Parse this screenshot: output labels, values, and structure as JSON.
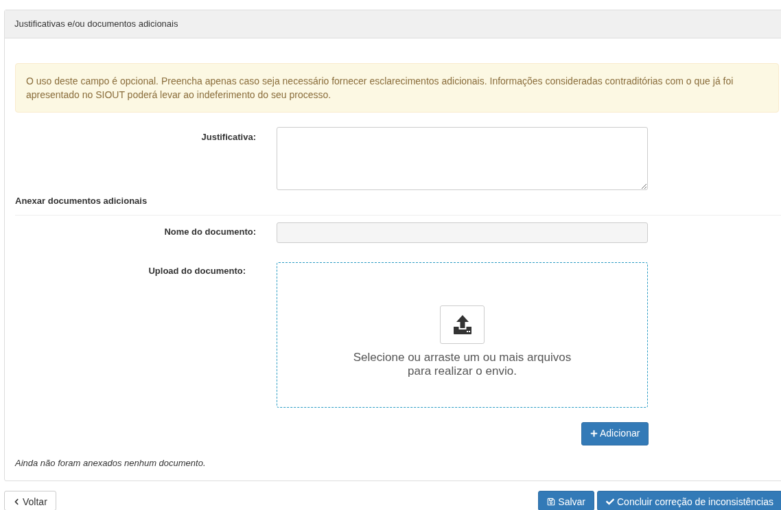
{
  "panel": {
    "title": "Justificativas e/ou documentos adicionais"
  },
  "alert": {
    "text": "O uso deste campo é opcional. Preencha apenas caso seja necessário fornecer esclarecimentos adicionais. Informações consideradas contraditórias com o que já foi apresentado no SIOUT poderá levar ao indeferimento do seu processo."
  },
  "justification": {
    "label": "Justificativa:"
  },
  "attachments": {
    "title": "Anexar documentos adicionais",
    "name_field": {
      "label": "Nome do documento:"
    },
    "upload": {
      "label": "Upload do documento:",
      "prompt_lines": [
        "Selecione ou arraste um ou mais arquivos",
        "para realizar o envio."
      ]
    },
    "add_button": "Adicionar",
    "empty_message": "Ainda não foram anexados nenhum documento."
  },
  "footer_buttons": [
    {
      "kind": "back",
      "label": "Voltar"
    },
    {
      "kind": "save",
      "label": "Salvar"
    },
    {
      "kind": "conclude",
      "label": "Concluir correção de inconsistências"
    }
  ]
}
